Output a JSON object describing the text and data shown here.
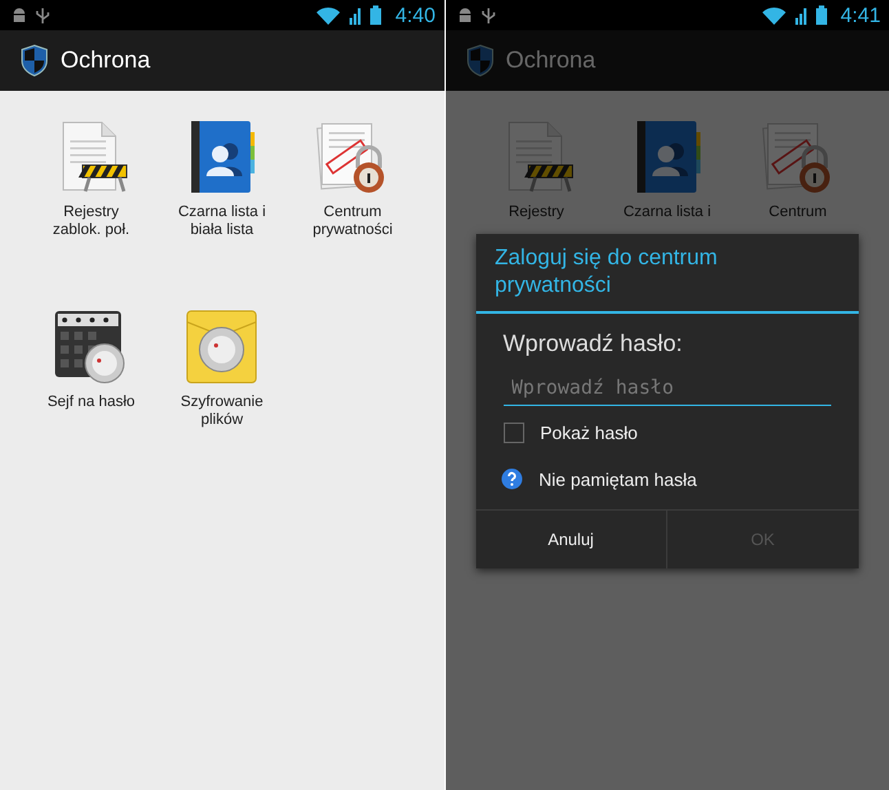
{
  "screens": [
    {
      "status_bar": {
        "time": "4:40"
      },
      "action_bar": {
        "title": "Ochrona"
      },
      "dimmed": false,
      "tiles": [
        {
          "kind": "blocked-log",
          "label": "Rejestry\nzablok. poł."
        },
        {
          "kind": "contacts",
          "label": "Czarna lista i\nbiała lista"
        },
        {
          "kind": "privacy",
          "label": "Centrum\nprywatności"
        },
        {
          "kind": "vault",
          "label": "Sejf na hasło"
        },
        {
          "kind": "encryption",
          "label": "Szyfrowanie\nplików"
        }
      ]
    },
    {
      "status_bar": {
        "time": "4:41"
      },
      "action_bar": {
        "title": "Ochrona"
      },
      "dimmed": true,
      "tiles": [
        {
          "kind": "blocked-log",
          "label": "Rejestry"
        },
        {
          "kind": "contacts",
          "label": "Czarna lista i"
        },
        {
          "kind": "privacy",
          "label": "Centrum"
        }
      ],
      "dialog": {
        "title": "Zaloguj się do centrum prywatności",
        "prompt": "Wprowadź hasło:",
        "input": {
          "placeholder": "Wprowadź hasło"
        },
        "checkbox": {
          "label": "Pokaż hasło",
          "checked": false
        },
        "help": "Nie pamiętam hasła",
        "buttons": [
          {
            "label": "Anuluj",
            "disabled": false
          },
          {
            "label": "OK",
            "disabled": true
          }
        ]
      }
    }
  ]
}
